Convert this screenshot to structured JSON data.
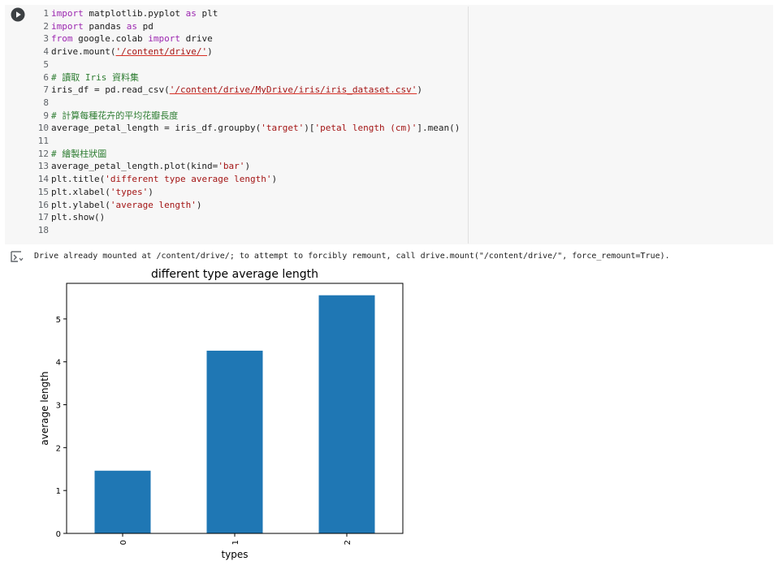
{
  "code_cell": {
    "lines": [
      {
        "n": "1",
        "parts": [
          {
            "t": "import",
            "c": "kw"
          },
          {
            "t": " matplotlib.pyplot "
          },
          {
            "t": "as",
            "c": "kw"
          },
          {
            "t": " plt"
          }
        ]
      },
      {
        "n": "2",
        "parts": [
          {
            "t": "import",
            "c": "kw"
          },
          {
            "t": " pandas "
          },
          {
            "t": "as",
            "c": "kw"
          },
          {
            "t": " pd"
          }
        ]
      },
      {
        "n": "3",
        "parts": [
          {
            "t": "from",
            "c": "kw"
          },
          {
            "t": " google.colab "
          },
          {
            "t": "import",
            "c": "kw"
          },
          {
            "t": " drive"
          }
        ]
      },
      {
        "n": "4",
        "parts": [
          {
            "t": "drive.mount("
          },
          {
            "t": "'/content/drive/'",
            "c": "str ul"
          },
          {
            "t": ")"
          }
        ]
      },
      {
        "n": "5",
        "parts": []
      },
      {
        "n": "6",
        "parts": [
          {
            "t": "# 讀取 Iris 資料集",
            "c": "cm"
          }
        ]
      },
      {
        "n": "7",
        "parts": [
          {
            "t": "iris_df = pd.read_csv("
          },
          {
            "t": "'/content/drive/MyDrive/iris/iris_dataset.csv'",
            "c": "str ul"
          },
          {
            "t": ")"
          }
        ]
      },
      {
        "n": "8",
        "parts": []
      },
      {
        "n": "9",
        "parts": [
          {
            "t": "# 計算每種花卉的平均花瓣長度",
            "c": "cm"
          }
        ]
      },
      {
        "n": "10",
        "parts": [
          {
            "t": "average_petal_length = iris_df.groupby("
          },
          {
            "t": "'target'",
            "c": "str"
          },
          {
            "t": ")["
          },
          {
            "t": "'petal length (cm)'",
            "c": "str"
          },
          {
            "t": "].mean()"
          }
        ]
      },
      {
        "n": "11",
        "parts": []
      },
      {
        "n": "12",
        "parts": [
          {
            "t": "# 繪製柱狀圖",
            "c": "cm"
          }
        ]
      },
      {
        "n": "13",
        "parts": [
          {
            "t": "average_petal_length.plot(kind="
          },
          {
            "t": "'bar'",
            "c": "str"
          },
          {
            "t": ")"
          }
        ]
      },
      {
        "n": "14",
        "parts": [
          {
            "t": "plt.title("
          },
          {
            "t": "'different type average length'",
            "c": "str"
          },
          {
            "t": ")"
          }
        ]
      },
      {
        "n": "15",
        "parts": [
          {
            "t": "plt.xlabel("
          },
          {
            "t": "'types'",
            "c": "str"
          },
          {
            "t": ")"
          }
        ]
      },
      {
        "n": "16",
        "parts": [
          {
            "t": "plt.ylabel("
          },
          {
            "t": "'average length'",
            "c": "str"
          },
          {
            "t": ")"
          }
        ]
      },
      {
        "n": "17",
        "parts": [
          {
            "t": "plt.show()"
          }
        ]
      },
      {
        "n": "18",
        "parts": []
      }
    ]
  },
  "output": {
    "text": "Drive already mounted at /content/drive/; to attempt to forcibly remount, call drive.mount(\"/content/drive/\", force_remount=True)."
  },
  "chart_data": {
    "type": "bar",
    "title": "different type average length",
    "xlabel": "types",
    "ylabel": "average length",
    "categories": [
      "0",
      "1",
      "2"
    ],
    "values": [
      1.462,
      4.26,
      5.552
    ],
    "ylim": [
      0,
      5.83
    ],
    "yticks": [
      "0",
      "1",
      "2",
      "3",
      "4",
      "5"
    ],
    "bar_color": "#1f77b4"
  },
  "colors": {
    "cell_bg": "#f7f7f7",
    "keyword": "#9c27b0",
    "string": "#a31515",
    "comment": "#2e7d32"
  }
}
